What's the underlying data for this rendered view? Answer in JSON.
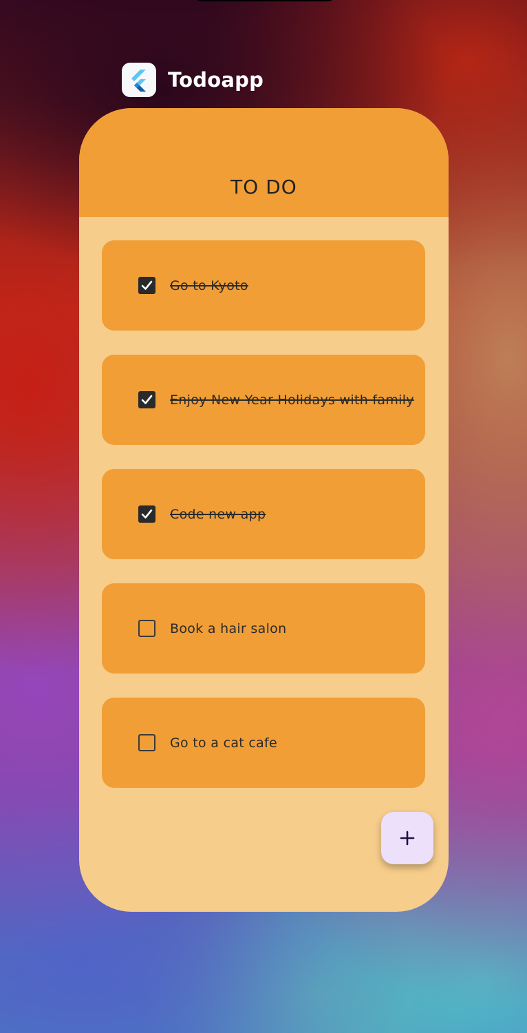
{
  "app_switcher": {
    "app_name": "Todoapp",
    "app_icon": "flutter-logo-icon"
  },
  "app": {
    "title": "TO DO",
    "colors": {
      "app_bar": "#f19e36",
      "background": "#f6cd8b",
      "item": "#f19e36",
      "fab": "#ece0fb"
    },
    "todos": [
      {
        "text": "Go to Kyoto",
        "done": true
      },
      {
        "text": "Enjoy New Year Holidays with family",
        "done": true
      },
      {
        "text": "Code new app",
        "done": true
      },
      {
        "text": "Book a hair salon",
        "done": false
      },
      {
        "text": "Go to a cat cafe",
        "done": false
      }
    ],
    "fab": {
      "label": "+",
      "icon": "plus-icon"
    }
  }
}
